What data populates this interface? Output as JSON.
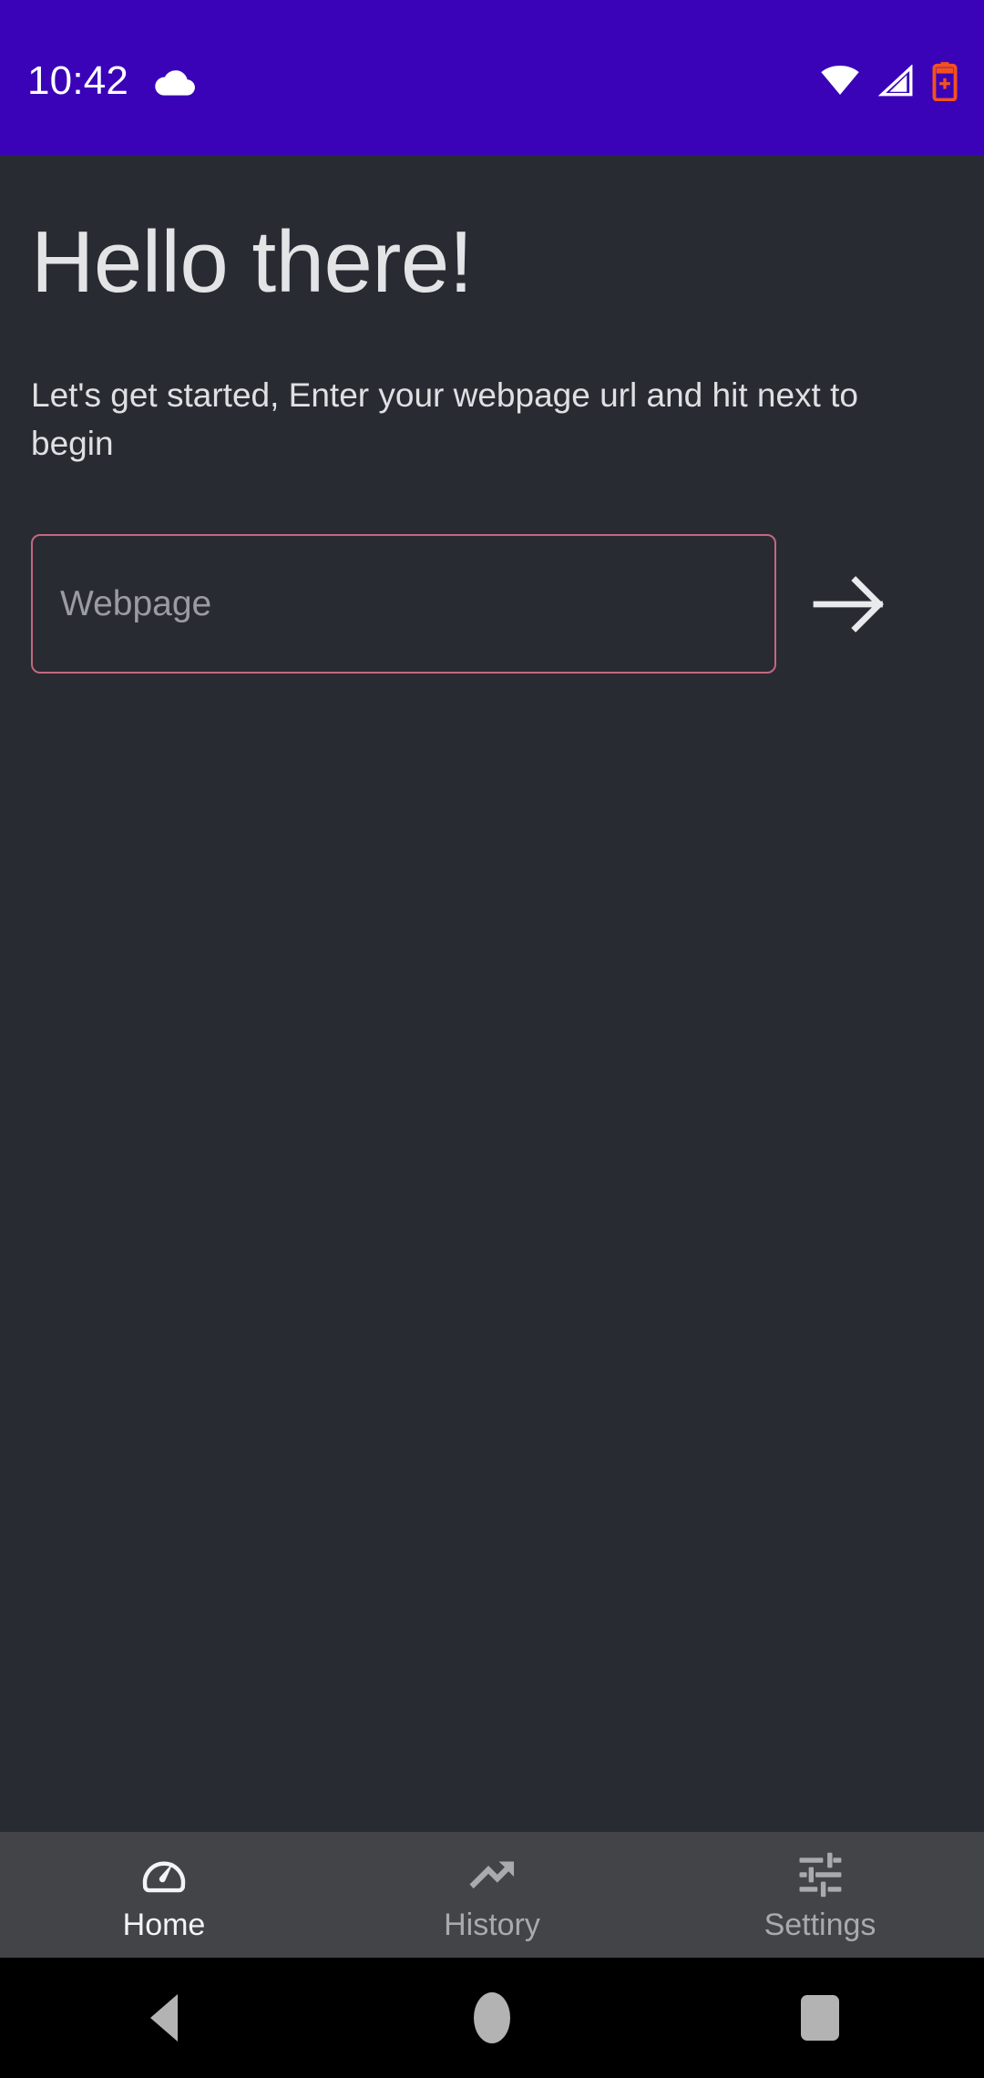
{
  "statusbar": {
    "time": "10:42",
    "left_icons": [
      {
        "name": "cloud-icon"
      }
    ],
    "right_icons": [
      {
        "name": "wifi-icon"
      },
      {
        "name": "cellular-signal-icon"
      },
      {
        "name": "battery-alert-icon"
      }
    ],
    "background_color": "#3a03b8",
    "foreground_color": "#ffffff",
    "battery_accent_color": "#f4511e"
  },
  "screen": {
    "background_color": "#292b33",
    "headline": "Hello there!",
    "subtitle": "Let's get started, Enter your webpage url and hit next to begin",
    "headline_color": "#e3e4e6"
  },
  "form": {
    "webpage_field": {
      "label": "Webpage",
      "placeholder": "Webpage",
      "value": "",
      "border_color": "#c4687e"
    },
    "next_button": {
      "icon": "arrow-right-icon",
      "label": "",
      "color": "#e9eaec"
    }
  },
  "tabbar": {
    "background_color": "#424448",
    "active_color": "#f3f4f5",
    "inactive_color": "#a8aaae",
    "items": [
      {
        "label": "Home",
        "icon": "speedometer-icon",
        "active": true
      },
      {
        "label": "History",
        "icon": "trending-up-icon",
        "active": false
      },
      {
        "label": "Settings",
        "icon": "tune-sliders-icon",
        "active": false
      }
    ]
  },
  "navbar": {
    "background_color": "#000000",
    "items": [
      {
        "name": "back-button",
        "icon": "triangle-back-icon"
      },
      {
        "name": "home-button",
        "icon": "circle-home-icon"
      },
      {
        "name": "recents-button",
        "icon": "square-recents-icon"
      }
    ]
  }
}
